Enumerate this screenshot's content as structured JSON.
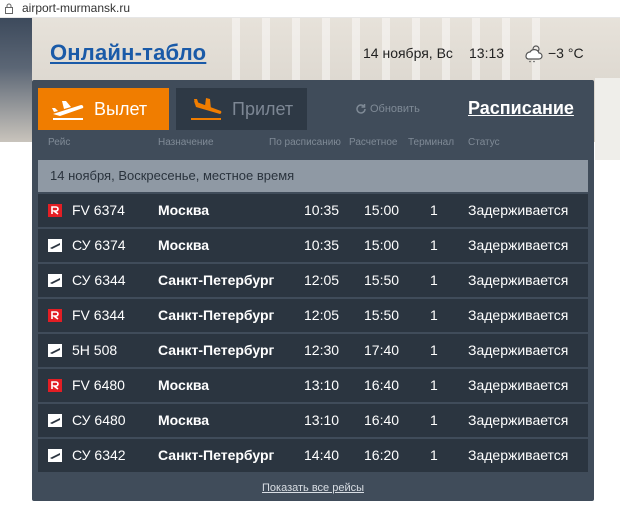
{
  "browser": {
    "url": "airport-murmansk.ru"
  },
  "header": {
    "title": "Онлайн-табло",
    "date": "14 ноября, Вс",
    "time": "13:13",
    "temperature": "−3 °C",
    "weather_icon": "cloud-sun-snow-icon"
  },
  "tabs": {
    "departure": "Вылет",
    "arrival": "Прилет",
    "active": "departure"
  },
  "toolbar": {
    "refresh": "Обновить",
    "schedule": "Расписание"
  },
  "columns": {
    "flight": "Рейс",
    "destination": "Назначение",
    "scheduled": "По расписанию",
    "estimated": "Расчетное",
    "terminal": "Терминал",
    "status": "Статус"
  },
  "day_header": "14 ноября, Воскресенье, местное время",
  "flights": [
    {
      "airline": "rossiya",
      "flight": "FV 6374",
      "destination": "Москва",
      "scheduled": "10:35",
      "estimated": "15:00",
      "terminal": "1",
      "status": "Задерживается"
    },
    {
      "airline": "other",
      "flight": "СУ 6374",
      "destination": "Москва",
      "scheduled": "10:35",
      "estimated": "15:00",
      "terminal": "1",
      "status": "Задерживается"
    },
    {
      "airline": "other",
      "flight": "СУ 6344",
      "destination": "Санкт-Петербург",
      "scheduled": "12:05",
      "estimated": "15:50",
      "terminal": "1",
      "status": "Задерживается"
    },
    {
      "airline": "rossiya",
      "flight": "FV 6344",
      "destination": "Санкт-Петербург",
      "scheduled": "12:05",
      "estimated": "15:50",
      "terminal": "1",
      "status": "Задерживается"
    },
    {
      "airline": "other",
      "flight": "5Н 508",
      "destination": "Санкт-Петербург",
      "scheduled": "12:30",
      "estimated": "17:40",
      "terminal": "1",
      "status": "Задерживается"
    },
    {
      "airline": "rossiya",
      "flight": "FV 6480",
      "destination": "Москва",
      "scheduled": "13:10",
      "estimated": "16:40",
      "terminal": "1",
      "status": "Задерживается"
    },
    {
      "airline": "other",
      "flight": "СУ 6480",
      "destination": "Москва",
      "scheduled": "13:10",
      "estimated": "16:40",
      "terminal": "1",
      "status": "Задерживается"
    },
    {
      "airline": "other",
      "flight": "СУ 6342",
      "destination": "Санкт-Петербург",
      "scheduled": "14:40",
      "estimated": "16:20",
      "terminal": "1",
      "status": "Задерживается"
    }
  ],
  "footer": {
    "show_all": "Показать все рейсы"
  },
  "colors": {
    "accent": "#f07d00",
    "board": "#404c5a",
    "row": "#2b3540",
    "rossiya_red": "#e31e24",
    "link": "#1a5aa8"
  }
}
